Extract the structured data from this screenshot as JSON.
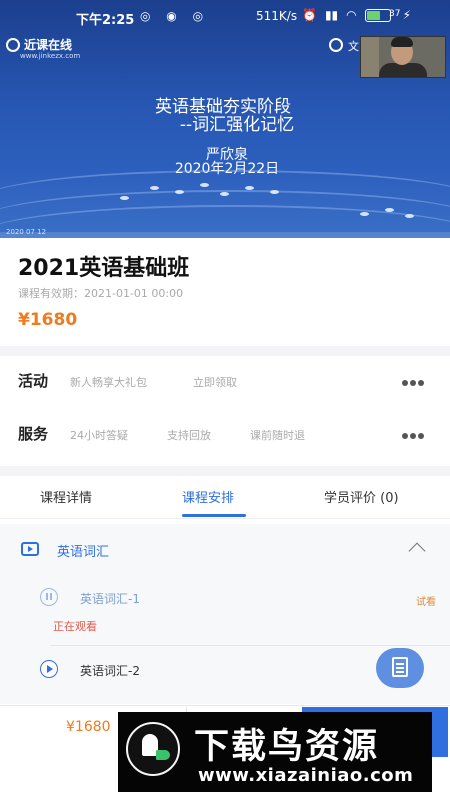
{
  "status_bar": {
    "time": "下午2:25",
    "speed": "511K/s",
    "battery": "37"
  },
  "video": {
    "brand": "近课在线",
    "brand_sub": "www.jinkezx.com",
    "corner_text": "文",
    "slide_lines": [
      "英语基础夯实阶段",
      "--词汇强化记忆",
      "严欣泉",
      "2020年2月22日"
    ],
    "bottom_tag": "2020 07 12"
  },
  "course": {
    "title": "2021英语基础班",
    "validity": "课程有效期：2021-01-01 00:00",
    "price": "¥1680"
  },
  "activity": {
    "label": "活动",
    "items": [
      "新人畅享大礼包",
      "立即领取"
    ]
  },
  "service": {
    "label": "服务",
    "items": [
      "24小时答疑",
      "支持回放",
      "课前随时退"
    ]
  },
  "tabs": [
    {
      "label": "课程详情"
    },
    {
      "label": "课程安排"
    },
    {
      "label": "学员评价 (0)"
    }
  ],
  "schedule": {
    "chapter_title": "英语词汇",
    "lessons": [
      {
        "title": "英语词汇-1",
        "tag": "试看",
        "status": "正在观看"
      },
      {
        "title": "英语词汇-2"
      }
    ]
  },
  "bottom_bar": {
    "price": "¥1680"
  },
  "watermark": {
    "title": "下载鸟资源",
    "url": "www.xiazainiao.com"
  },
  "colors": {
    "accent": "#2f6fe0",
    "price": "#f07a1e",
    "live": "#e05a4a"
  }
}
